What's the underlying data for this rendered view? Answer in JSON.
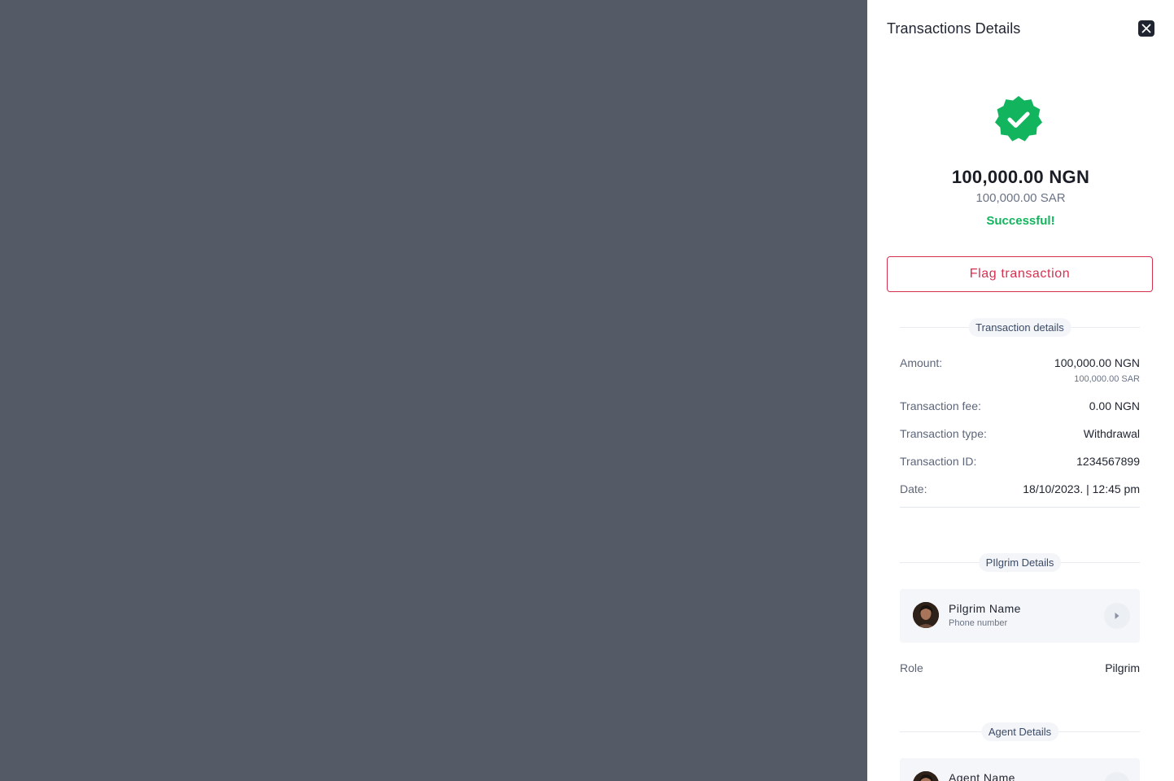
{
  "panel": {
    "title": "Transactions Details",
    "amount_main": "100,000.00 NGN",
    "amount_sub": "100,000.00 SAR",
    "status": "Successful!",
    "flag_label": "Flag transaction"
  },
  "transaction_details": {
    "heading": "Transaction details",
    "rows": [
      {
        "label": "Amount:",
        "value": "100,000.00 NGN",
        "sub": "100,000.00 SAR"
      },
      {
        "label": "Transaction fee:",
        "value": "0.00 NGN"
      },
      {
        "label": "Transaction type:",
        "value": "Withdrawal"
      },
      {
        "label": "Transaction ID:",
        "value": "1234567899"
      },
      {
        "label": "Date:",
        "value": "18/10/2023. | 12:45 pm"
      }
    ]
  },
  "pilgrim_details": {
    "heading": "PIlgrim Details",
    "name": "Pilgrim Name",
    "phone": "Phone number",
    "role_label": "Role",
    "role_value": "Pilgrim"
  },
  "agent_details": {
    "heading": "Agent Details",
    "name": "Agent Name"
  },
  "colors": {
    "success": "#12b55d",
    "danger": "#d6304f",
    "overlay": "#545a66"
  },
  "icons": {
    "close": "close-icon",
    "badge": "verified-badge-icon",
    "chevron": "chevron-right-icon"
  }
}
